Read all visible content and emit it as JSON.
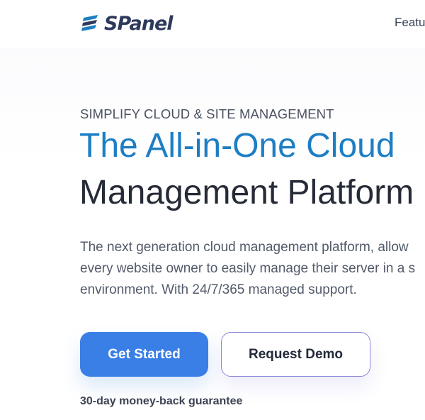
{
  "header": {
    "brand": "SPanel",
    "logo_icon": "spanel-stripes-logo-icon",
    "nav_items": [
      "Featu"
    ]
  },
  "hero": {
    "eyebrow": "SIMPLIFY CLOUD & SITE MANAGEMENT",
    "title_line_1": "The All-in-One Cloud",
    "title_line_2": "Management Platform",
    "description_lines": [
      "The next generation cloud management platform, allow",
      "every website owner to easily manage their server in a s",
      "environment. With 24/7/365 managed support."
    ],
    "primary_cta": "Get Started",
    "secondary_cta": "Request Demo",
    "guarantee": "30-day money-back guarantee"
  },
  "colors": {
    "accent_blue": "#1d7ec4",
    "button_blue": "#3a7fe6",
    "heading_dark": "#262b38",
    "outline_purple": "#8a88d8"
  }
}
